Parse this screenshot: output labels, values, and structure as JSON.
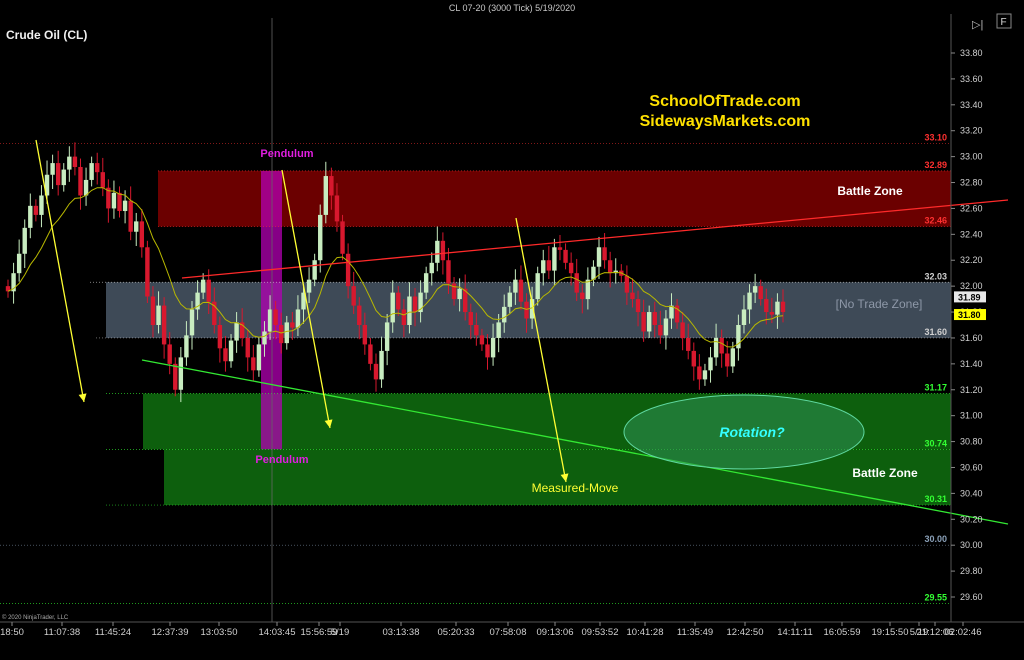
{
  "window": {
    "title": "CL 07-20 (3000 Tick)  5/19/2020",
    "icons": [
      "play-forward-icon",
      "properties-icon"
    ],
    "icon_glyphs": {
      "play": "▷|",
      "props": "F"
    }
  },
  "instrument": "Crude Oil (CL)",
  "copyright": "© 2020 NinjaTrader, LLC",
  "brand": {
    "line1": "SchoolOfTrade.com",
    "line2": "SidewaysMarkets.com",
    "color": "#ffe100"
  },
  "colors": {
    "background": "#000000",
    "up_candle": "#c8ecc0",
    "down_candle": "#d8182e",
    "zone_red": "#6b0000",
    "zone_gray": "#3e4a57",
    "zone_green": "#0d5f0d",
    "pendulum": "#b300b3",
    "arrow": "#ffff33",
    "trend_red": "#ff2a2a",
    "trend_green": "#33e833",
    "moving_avg": "#b8b800",
    "ellipse": "#2f8f55"
  },
  "chart_data": {
    "type": "candlestick",
    "title": "CL 07-20 (3000 Tick)  5/19/2020",
    "instrument": "Crude Oil (CL)",
    "ylim": [
      29.45,
      33.95
    ],
    "y_ticks": [
      29.6,
      29.8,
      30.0,
      30.2,
      30.4,
      30.6,
      30.8,
      31.0,
      31.2,
      31.4,
      31.6,
      31.8,
      32.0,
      32.2,
      32.4,
      32.6,
      32.8,
      33.0,
      33.2,
      33.4,
      33.6,
      33.8
    ],
    "y_tick_labels": [
      "29.60",
      "29.80",
      "30.00",
      "30.20",
      "30.40",
      "30.60",
      "30.80",
      "31.00",
      "31.20",
      "31.40",
      "31.60",
      "31.80",
      "32.00",
      "32.20",
      "32.40",
      "32.60",
      "32.80",
      "33.00",
      "33.20",
      "33.40",
      "33.60",
      "33.80"
    ],
    "x_labels": [
      "18:50",
      "11:07:38",
      "11:45:24",
      "12:37:39",
      "13:03:50",
      "14:03:45",
      "15:56:59",
      "5/19",
      "03:13:38",
      "05:20:33",
      "07:58:08",
      "09:13:06",
      "09:53:52",
      "10:41:28",
      "11:35:49",
      "12:42:50",
      "14:11:11",
      "16:05:59",
      "19:15:50",
      "21:12:06",
      "5/19",
      "02:02:46"
    ],
    "price_levels": [
      {
        "value": 33.1,
        "label": "33.10",
        "color": "#ff3030"
      },
      {
        "value": 32.89,
        "label": "32.89",
        "color": "#ff3030"
      },
      {
        "value": 32.46,
        "label": "32.46",
        "color": "#ff3030"
      },
      {
        "value": 32.03,
        "label": "32.03",
        "color": "#d0d0d0"
      },
      {
        "value": 31.6,
        "label": "31.60",
        "color": "#d0d0d0"
      },
      {
        "value": 31.17,
        "label": "31.17",
        "color": "#33ff33"
      },
      {
        "value": 30.74,
        "label": "30.74",
        "color": "#33ff33"
      },
      {
        "value": 30.31,
        "label": "30.31",
        "color": "#33ff33"
      },
      {
        "value": 30.0,
        "label": "30.00",
        "color": "#8aa0b8"
      },
      {
        "value": 29.55,
        "label": "29.55",
        "color": "#33ff33"
      }
    ],
    "current_prices": [
      {
        "value": 31.89,
        "label": "31.89"
      },
      {
        "value": 31.8,
        "label": "31.80"
      }
    ],
    "zones": [
      {
        "label": "Battle Zone",
        "low": 32.46,
        "high": 32.89
      },
      {
        "label": "[No Trade Zone]",
        "low": 31.6,
        "high": 32.03
      },
      {
        "label": "",
        "low": 30.74,
        "high": 31.17
      },
      {
        "label": "Battle Zone",
        "low": 30.31,
        "high": 30.74
      }
    ],
    "annotations": [
      "Pendulum",
      "Pendulum",
      "Measured-Move",
      "Rotation?"
    ],
    "candles_close": [
      31.96,
      32.1,
      32.25,
      32.45,
      32.62,
      32.55,
      32.7,
      32.86,
      32.95,
      32.78,
      32.9,
      33.0,
      32.92,
      32.7,
      32.82,
      32.95,
      32.88,
      32.76,
      32.6,
      32.72,
      32.58,
      32.66,
      32.42,
      32.5,
      32.3,
      31.92,
      31.7,
      31.85,
      31.55,
      31.4,
      31.2,
      31.45,
      31.62,
      31.82,
      31.95,
      32.05,
      31.88,
      31.7,
      31.52,
      31.42,
      31.58,
      31.72,
      31.6,
      31.45,
      31.35,
      31.55,
      31.65,
      31.82,
      31.7,
      31.56,
      31.72,
      31.68,
      31.82,
      31.95,
      32.05,
      32.2,
      32.55,
      32.85,
      32.7,
      32.5,
      32.25,
      32.0,
      31.85,
      31.7,
      31.55,
      31.4,
      31.28,
      31.5,
      31.72,
      31.95,
      31.82,
      31.7,
      31.92,
      31.8,
      31.95,
      32.1,
      32.18,
      32.35,
      32.2,
      32.02,
      31.9,
      31.98,
      31.8,
      31.7,
      31.62,
      31.55,
      31.45,
      31.6,
      31.72,
      31.84,
      31.95,
      32.05,
      31.88,
      31.75,
      31.9,
      32.1,
      32.2,
      32.12,
      32.3,
      32.28,
      32.18,
      32.1,
      31.95,
      31.9,
      32.05,
      32.15,
      32.3,
      32.2,
      32.1,
      32.12,
      32.08,
      31.95,
      31.9,
      31.8,
      31.65,
      31.8,
      31.7,
      31.62,
      31.75,
      31.85,
      31.72,
      31.6,
      31.5,
      31.38,
      31.28,
      31.35,
      31.45,
      31.6,
      31.48,
      31.38,
      31.52,
      31.7,
      31.82,
      31.95,
      32.0,
      31.9,
      31.8,
      31.78,
      31.88,
      31.8
    ]
  },
  "labels": {
    "battle_zone_top": "Battle Zone",
    "no_trade_zone": "[No Trade Zone]",
    "battle_zone_bottom": "Battle Zone",
    "pendulum_top": "Pendulum",
    "pendulum_bottom": "Pendulum",
    "measured_move": "Measured-Move",
    "rotation": "Rotation?"
  }
}
